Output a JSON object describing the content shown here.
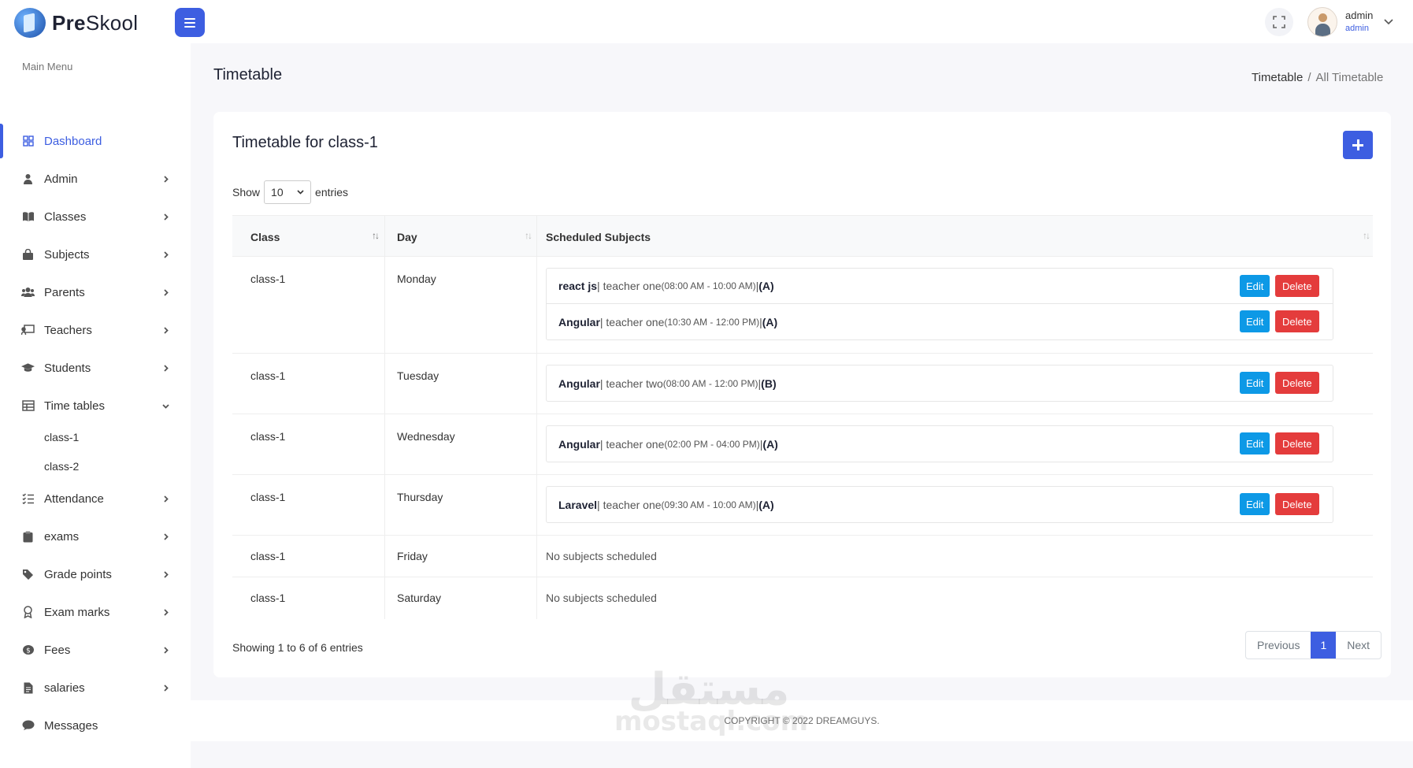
{
  "brand": {
    "name_bold": "Pre",
    "name_rest": "Skool"
  },
  "header": {
    "user_name": "admin",
    "user_role": "admin"
  },
  "sidebar": {
    "section_title": "Main Menu",
    "items": [
      {
        "label": "Dashboard",
        "icon": "grid-icon"
      },
      {
        "label": "Admin",
        "icon": "user-icon"
      },
      {
        "label": "Classes",
        "icon": "book-icon"
      },
      {
        "label": "Subjects",
        "icon": "bag-icon"
      },
      {
        "label": "Parents",
        "icon": "users-icon"
      },
      {
        "label": "Teachers",
        "icon": "chalkboard-icon"
      },
      {
        "label": "Students",
        "icon": "graduation-cap-icon"
      },
      {
        "label": "Time tables",
        "icon": "table-icon"
      },
      {
        "label": "Attendance",
        "icon": "list-check-icon"
      },
      {
        "label": "exams",
        "icon": "clipboard-icon"
      },
      {
        "label": "Grade points",
        "icon": "tag-icon"
      },
      {
        "label": "Exam marks",
        "icon": "award-icon"
      },
      {
        "label": "Fees",
        "icon": "coin-icon"
      },
      {
        "label": "salaries",
        "icon": "file-invoice-icon"
      },
      {
        "label": "Messages",
        "icon": "chat-icon"
      }
    ],
    "timetable_sub": [
      "class-1",
      "class-2"
    ]
  },
  "page": {
    "title": "Timetable",
    "breadcrumb": [
      "Timetable",
      "All Timetable"
    ],
    "breadcrumb_sep": "/"
  },
  "card": {
    "title": "Timetable for class-1",
    "show_label": "Show",
    "entries_label": "entries",
    "page_length": "10",
    "columns": [
      "Class",
      "Day",
      "Scheduled Subjects"
    ],
    "rows": [
      {
        "class": "class-1",
        "day": "Monday",
        "subjects": [
          {
            "name": "react js",
            "teacher": " | teacher one ",
            "time": "(08:00 AM - 10:00 AM)",
            "sep": " | ",
            "group": "(A)"
          },
          {
            "name": "Angular",
            "teacher": " | teacher one ",
            "time": "(10:30 AM - 12:00 PM)",
            "sep": " | ",
            "group": "(A)"
          }
        ]
      },
      {
        "class": "class-1",
        "day": "Tuesday",
        "subjects": [
          {
            "name": "Angular",
            "teacher": " | teacher two ",
            "time": "(08:00 AM - 12:00 PM)",
            "sep": " | ",
            "group": "(B)"
          }
        ]
      },
      {
        "class": "class-1",
        "day": "Wednesday",
        "subjects": [
          {
            "name": "Angular",
            "teacher": " | teacher one ",
            "time": "(02:00 PM - 04:00 PM)",
            "sep": " | ",
            "group": "(A)"
          }
        ]
      },
      {
        "class": "class-1",
        "day": "Thursday",
        "subjects": [
          {
            "name": "Laravel",
            "teacher": " | teacher one ",
            "time": "(09:30 AM - 10:00 AM)",
            "sep": " | ",
            "group": "(A)"
          }
        ]
      },
      {
        "class": "class-1",
        "day": "Friday",
        "subjects": [],
        "empty_text": "No subjects scheduled"
      },
      {
        "class": "class-1",
        "day": "Saturday",
        "subjects": [],
        "empty_text": "No subjects scheduled"
      }
    ],
    "edit_label": "Edit",
    "delete_label": "Delete",
    "info": "Showing 1 to 6 of 6 entries",
    "pagination": {
      "previous": "Previous",
      "current": "1",
      "next": "Next"
    }
  },
  "footer": {
    "text": "COPYRIGHT © 2022 DREAMGUYS."
  },
  "watermark": {
    "arabic": "مستقل",
    "latin": "mostaql.com"
  },
  "colors": {
    "primary": "#3d5ee1",
    "edit": "#0d99e6",
    "delete": "#e43c3c"
  }
}
